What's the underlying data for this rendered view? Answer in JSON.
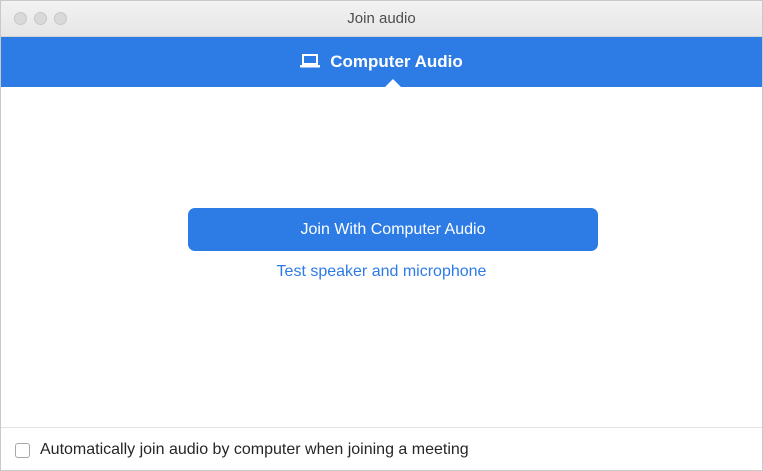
{
  "window": {
    "title": "Join audio"
  },
  "tabs": [
    {
      "label": "Computer Audio",
      "icon": "laptop-icon",
      "selected": true
    }
  ],
  "main": {
    "join_button_label": "Join With Computer Audio",
    "test_link_label": "Test speaker and microphone"
  },
  "footer": {
    "auto_join_label": "Automatically join audio by computer when joining a meeting",
    "auto_join_checked": false
  },
  "colors": {
    "accent": "#2d7be5",
    "tab_text": "#ffffff",
    "link": "#2d7be5"
  }
}
